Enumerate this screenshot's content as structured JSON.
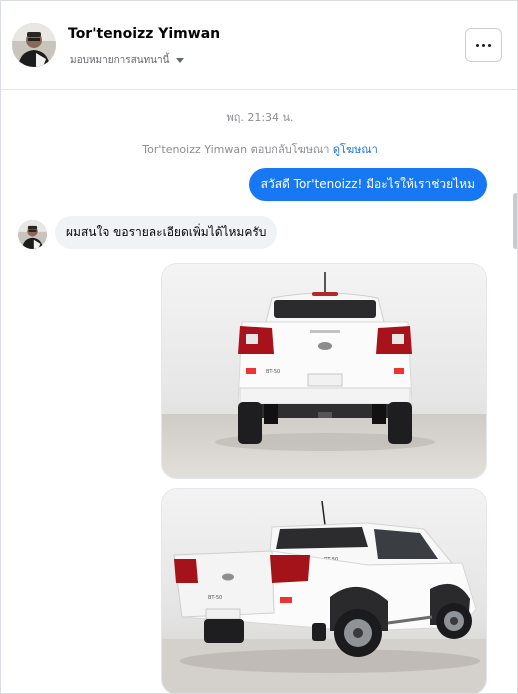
{
  "header": {
    "contact_name": "Tor'tenoizz Yimwan",
    "assign_label": "มอบหมายการสนทนานี้",
    "more_button": "more-options"
  },
  "thread": {
    "timestamp": "พฤ. 21:34 น.",
    "system_message": "Tor'tenoizz Yimwan ตอบกลับโฆษณา",
    "system_link": "ดูโฆษณา",
    "messages": [
      {
        "direction": "outgoing",
        "text": "สวัสดี Tor'tenoizz! มีอะไรให้เราช่วยไหม"
      },
      {
        "direction": "incoming",
        "text": "ผมสนใจ ขอรายละเอียดเพิ่มได้ไหมครับ"
      }
    ],
    "photos": [
      {
        "plate_text": "BT-50"
      },
      {
        "plate_text": "BT-50",
        "decal_text": "BT-50"
      }
    ]
  },
  "colors": {
    "outgoing_bubble": "#1877f2",
    "incoming_bubble": "#f0f2f5",
    "link": "#1b74e4",
    "muted_text": "#8a8d91"
  },
  "icons": [
    "caret-down-icon",
    "more-dots-icon",
    "avatar-photo",
    "car-photo"
  ]
}
